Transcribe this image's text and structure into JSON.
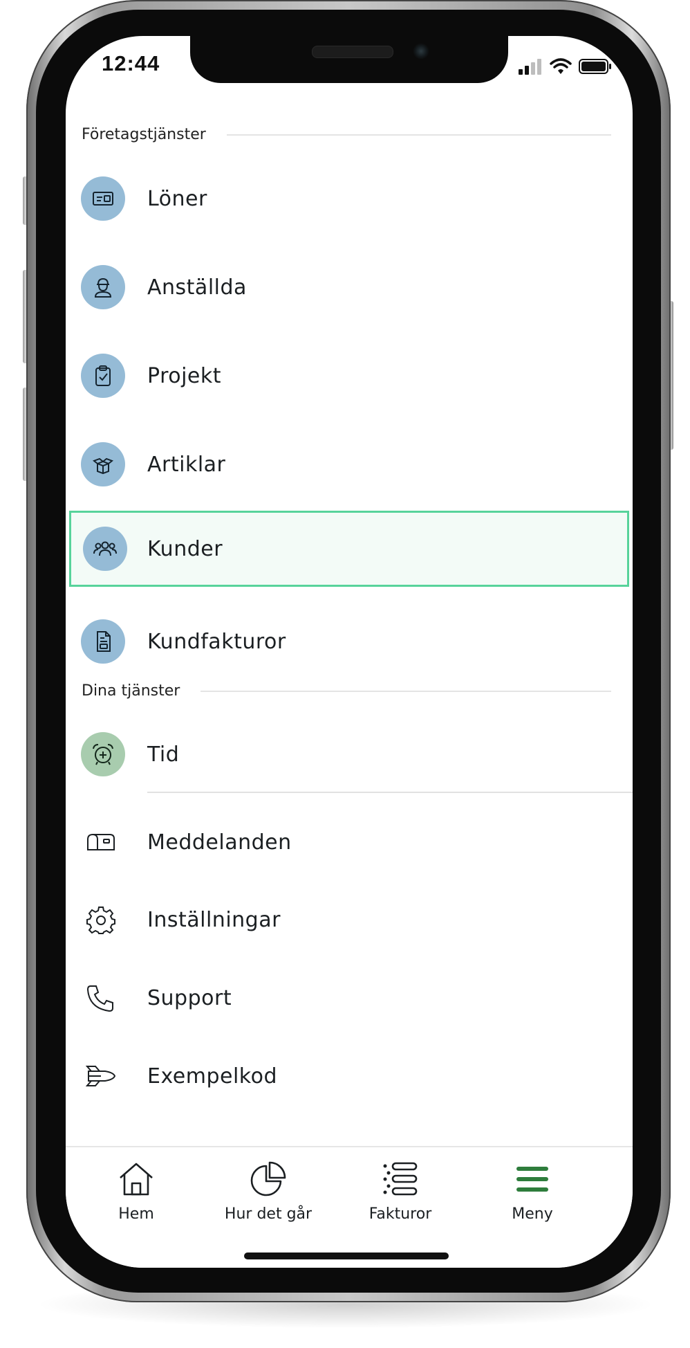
{
  "status_bar": {
    "time": "12:44"
  },
  "sections": {
    "business": "Företagstjänster",
    "yours": "Dina tjänster"
  },
  "menu": {
    "business_items": [
      {
        "label": "Löner",
        "icon": "payslip-icon"
      },
      {
        "label": "Anställda",
        "icon": "worker-icon"
      },
      {
        "label": "Projekt",
        "icon": "clipboard-check-icon"
      },
      {
        "label": "Artiklar",
        "icon": "open-box-icon"
      },
      {
        "label": "Kunder",
        "icon": "people-icon",
        "highlighted": true
      },
      {
        "label": "Kundfakturor",
        "icon": "invoice-document-icon"
      }
    ],
    "your_items": [
      {
        "label": "Tid",
        "icon": "alarm-clock-icon"
      }
    ],
    "other_items": [
      {
        "label": "Meddelanden",
        "icon": "mailbox-icon"
      },
      {
        "label": "Inställningar",
        "icon": "gear-icon"
      },
      {
        "label": "Support",
        "icon": "phone-icon"
      },
      {
        "label": "Exempelkod",
        "icon": "shuttle-icon"
      }
    ]
  },
  "tabs": [
    {
      "label": "Hem",
      "icon": "home-icon"
    },
    {
      "label": "Hur det går",
      "icon": "pie-chart-icon"
    },
    {
      "label": "Fakturor",
      "icon": "list-icon"
    },
    {
      "label": "Meny",
      "icon": "hamburger-menu-icon",
      "active": true
    }
  ],
  "colors": {
    "business_icon_bg": "#95bbd6",
    "your_icon_bg": "#a8ccae",
    "highlight_border": "#57d39b",
    "active_tab": "#2e7d3c"
  }
}
